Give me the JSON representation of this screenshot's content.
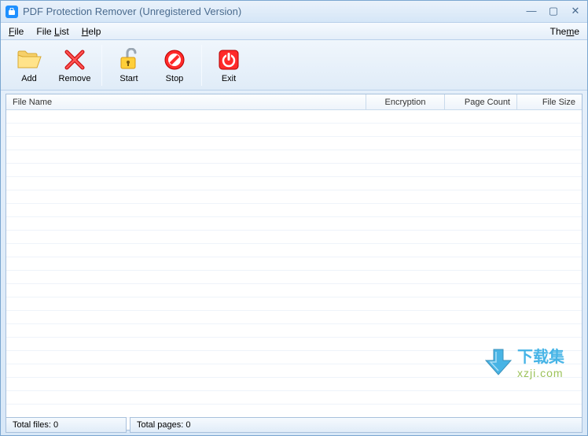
{
  "titlebar": {
    "title": "PDF Protection Remover (Unregistered Version)"
  },
  "menubar": {
    "file": "File",
    "filelist": "File List",
    "help": "Help",
    "theme": "Theme"
  },
  "toolbar": {
    "add": "Add",
    "remove": "Remove",
    "start": "Start",
    "stop": "Stop",
    "exit": "Exit"
  },
  "table": {
    "headers": {
      "filename": "File Name",
      "encryption": "Encryption",
      "pagecount": "Page Count",
      "filesize": "File Size"
    }
  },
  "status": {
    "totalfiles": "Total files: 0",
    "totalpages": "Total pages: 0"
  },
  "watermark": {
    "line1": "下载集",
    "line2": "xzji.com"
  }
}
